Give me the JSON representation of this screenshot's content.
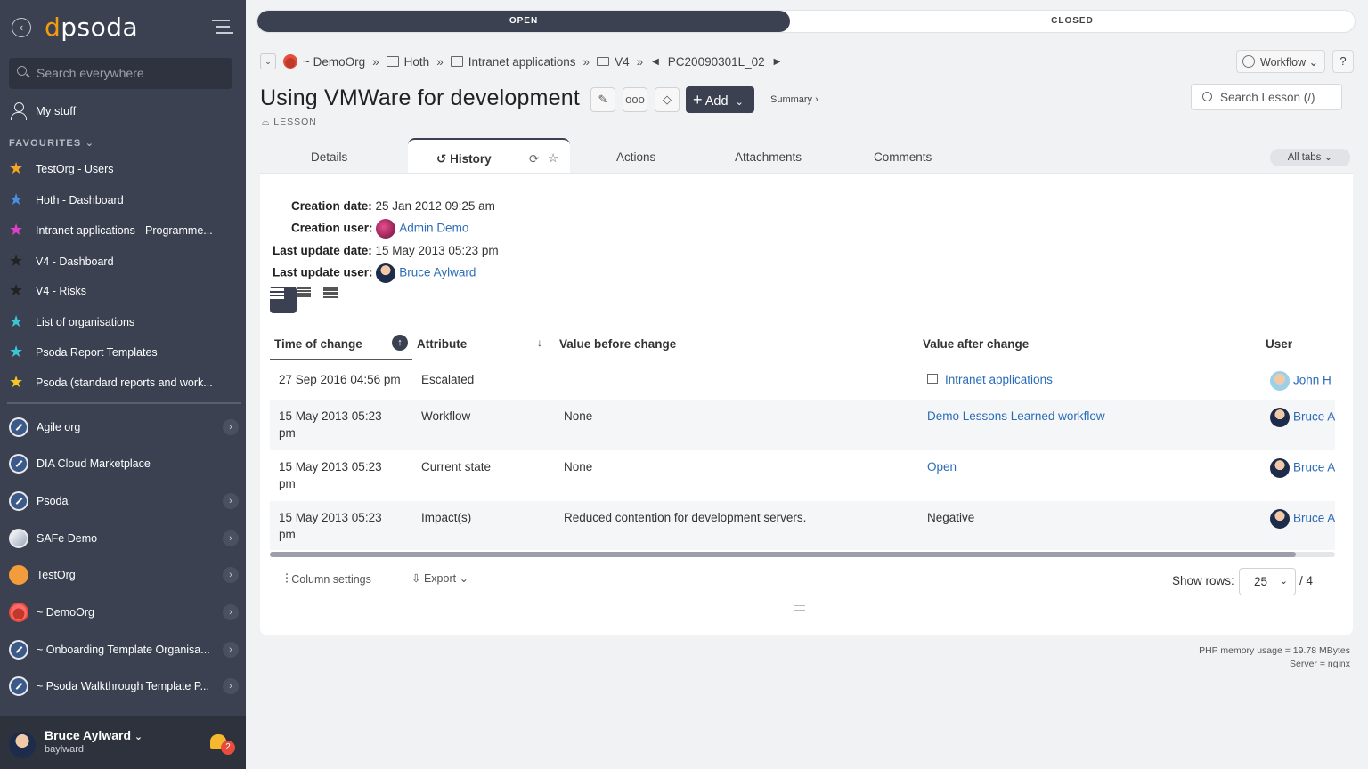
{
  "sidebar": {
    "logo": "psoda",
    "search_placeholder": "Search everywhere",
    "my_stuff": "My stuff",
    "favourites_heading": "FAVOURITES",
    "favourites": [
      {
        "label": "TestOrg - Users",
        "color": "#f5a623"
      },
      {
        "label": "Hoth - Dashboard",
        "color": "#4a90e2"
      },
      {
        "label": "Intranet applications - Programme...",
        "color": "#e040c8"
      },
      {
        "label": "V4 - Dashboard",
        "color": "#222222"
      },
      {
        "label": "V4 - Risks",
        "color": "#222222"
      },
      {
        "label": "List of organisations",
        "color": "#3cc4d8"
      },
      {
        "label": "Psoda Report Templates",
        "color": "#3cc4d8"
      },
      {
        "label": "Psoda (standard reports and work...",
        "color": "#f5c623"
      }
    ],
    "organisations": [
      {
        "label": "Agile org"
      },
      {
        "label": "DIA Cloud Marketplace"
      },
      {
        "label": "Psoda"
      },
      {
        "label": "SAFe Demo"
      },
      {
        "label": "TestOrg"
      },
      {
        "label": "~ DemoOrg"
      },
      {
        "label": "~ Onboarding Template Organisa..."
      },
      {
        "label": "~ Psoda Walkthrough Template P..."
      }
    ],
    "user": {
      "name": "Bruce Aylward",
      "username": "baylward",
      "notifications": "2"
    }
  },
  "status_bar": {
    "open": "OPEN",
    "closed": "CLOSED"
  },
  "breadcrumb": {
    "org": "~ DemoOrg",
    "portfolio": "Hoth",
    "programme": "Intranet applications",
    "project": "V4",
    "item": "PC20090301L_02"
  },
  "header": {
    "workflow": "Workflow",
    "help": "?",
    "title": "Using VMWare for development",
    "add": "Add",
    "summary": "Summary ›",
    "type_label": "LESSON",
    "search_placeholder": "Search Lesson (/)"
  },
  "tabs": {
    "details": "Details",
    "history": "History",
    "actions": "Actions",
    "attachments": "Attachments",
    "comments": "Comments",
    "all_tabs": "All tabs"
  },
  "meta": {
    "creation_date_label": "Creation date:",
    "creation_date": "25 Jan 2012 09:25 am",
    "creation_user_label": "Creation user:",
    "creation_user": "Admin Demo",
    "last_update_date_label": "Last update date:",
    "last_update_date": "15 May 2013 05:23 pm",
    "last_update_user_label": "Last update user:",
    "last_update_user": "Bruce Aylward"
  },
  "table": {
    "columns": [
      "Time of change",
      "Attribute",
      "Value before change",
      "Value after change",
      "User"
    ],
    "rows": [
      {
        "time": "27 Sep 2016 04:56 pm",
        "attribute": "Escalated",
        "before": "",
        "after": "Intranet applications",
        "user": "John H"
      },
      {
        "time": "15 May 2013 05:23 pm",
        "attribute": "Workflow",
        "before": "None",
        "after": "Demo Lessons Learned workflow",
        "user": "Bruce A"
      },
      {
        "time": "15 May 2013 05:23 pm",
        "attribute": "Current state",
        "before": "None",
        "after": "Open",
        "user": "Bruce A"
      },
      {
        "time": "15 May 2013 05:23 pm",
        "attribute": "Impact(s)",
        "before": "Reduced contention for development servers.",
        "after": "Negative",
        "user": "Bruce A"
      }
    ]
  },
  "footer": {
    "column_settings": "Column settings",
    "export": "Export",
    "show_rows_label": "Show rows:",
    "show_rows": "25",
    "total": "/ 4"
  },
  "server": {
    "memory": "PHP memory usage = 19.78 MBytes",
    "server": "Server = nginx"
  }
}
